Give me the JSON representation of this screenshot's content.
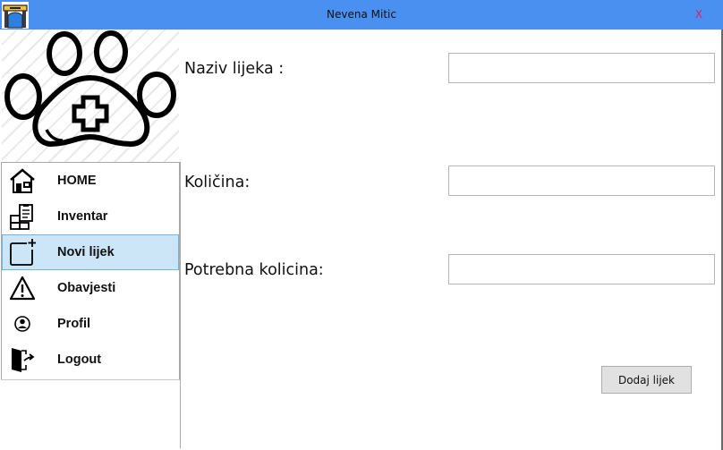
{
  "window": {
    "title": "Nevena Mitic",
    "close_label": "X",
    "app_icon": "bridge-icon"
  },
  "logo": {
    "icon": "paw-cross-icon"
  },
  "sidebar": {
    "items": [
      {
        "label": "HOME",
        "icon": "house-icon",
        "active": false
      },
      {
        "label": "Inventar",
        "icon": "inventory-icon",
        "active": false
      },
      {
        "label": "Novi lijek",
        "icon": "add-page-icon",
        "active": true
      },
      {
        "label": "Obavjesti",
        "icon": "warning-icon",
        "active": false
      },
      {
        "label": "Profil",
        "icon": "user-icon",
        "active": false
      },
      {
        "label": "Logout",
        "icon": "logout-door-icon",
        "active": false
      }
    ]
  },
  "form": {
    "name_label": "Naziv lijeka :",
    "name_value": "",
    "quantity_label": "Količina:",
    "quantity_value": "",
    "required_label": "Potrebna kolicina:",
    "required_value": "",
    "submit_label": "Dodaj lijek"
  },
  "colors": {
    "titlebar": "#4a90f0",
    "close": "#e01f5a",
    "active_item": "#cce6f7"
  }
}
